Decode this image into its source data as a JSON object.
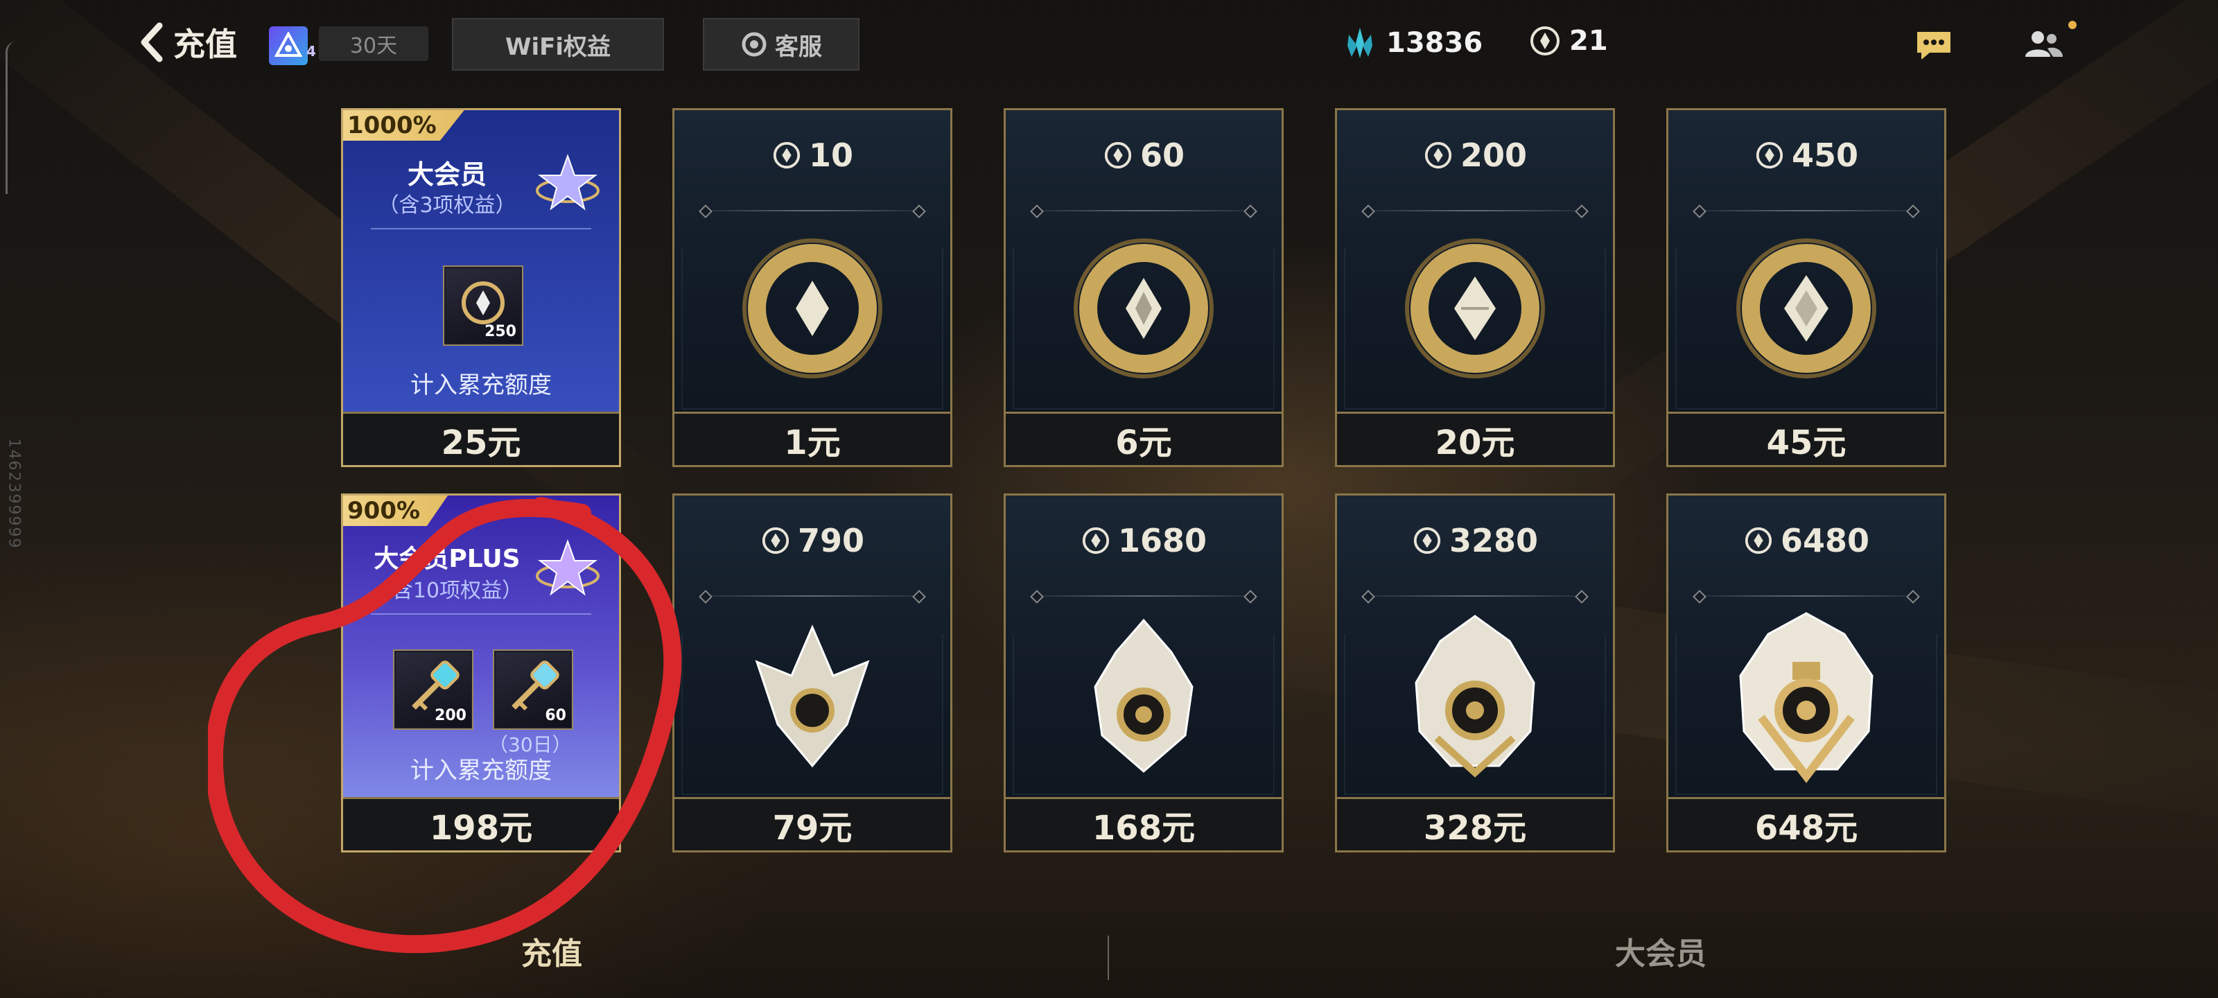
{
  "header": {
    "title": "充值",
    "vip_level": "4",
    "days": "30天",
    "wifi_label": "WiFi权益",
    "service_label": "客服",
    "blue_currency": "13836",
    "gold_currency": "21"
  },
  "vip_cards": [
    {
      "percent": "1000%",
      "name": "大会员",
      "subtitle": "（含3项权益）",
      "item_count": "250",
      "note": "计入累充额度",
      "price": "25元"
    },
    {
      "percent": "900%",
      "name": "大会员PLUS",
      "subtitle": "（含10项权益）",
      "item1_count": "200",
      "item2_count": "60",
      "item2_days": "（30日）",
      "note": "计入累充额度",
      "price": "198元"
    }
  ],
  "cards": [
    {
      "amount": "10",
      "price": "1元"
    },
    {
      "amount": "60",
      "price": "6元"
    },
    {
      "amount": "200",
      "price": "20元"
    },
    {
      "amount": "450",
      "price": "45元"
    },
    {
      "amount": "790",
      "price": "79元"
    },
    {
      "amount": "1680",
      "price": "168元"
    },
    {
      "amount": "3280",
      "price": "328元"
    },
    {
      "amount": "6480",
      "price": "648元"
    }
  ],
  "tabs": {
    "recharge": "充值",
    "vip": "大会员"
  },
  "colors": {
    "gold": "#c9a85c",
    "card_border": "#8b7649",
    "vip_blue": "#2a3ea6",
    "annotation_red": "#d8282c"
  },
  "side_id": "1462399999"
}
